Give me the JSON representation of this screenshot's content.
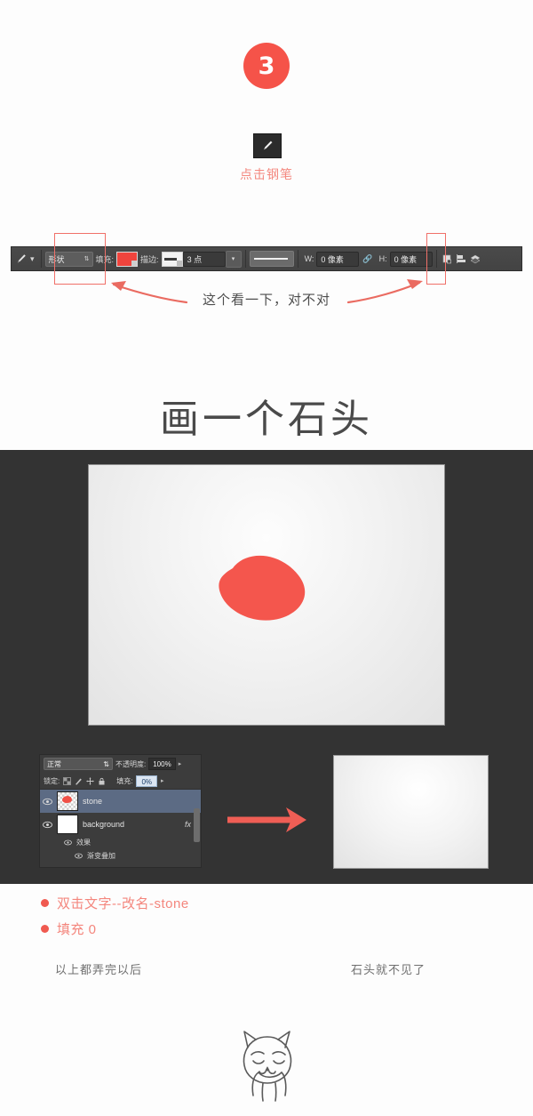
{
  "tutorial": {
    "step_number": "3",
    "pen_caption": "点击钢笔",
    "toolbar_note": "这个看一下，对不对",
    "section_title": "画一个石头"
  },
  "icons": {
    "pen_tool": "pen-tool-icon",
    "link_chain": "link-chain-icon",
    "path_operations": "path-operations-icon",
    "path_alignment": "path-alignment-icon",
    "path_arrangement": "path-arrangement-icon",
    "eye": "eye-icon",
    "lock_transparency": "lock-transparent-pixels-icon",
    "lock_image": "lock-image-pixels-icon",
    "lock_position": "lock-position-icon",
    "lock_all": "lock-all-icon"
  },
  "options_bar": {
    "tool_mode": {
      "value": "形状"
    },
    "fill": {
      "label": "填充:",
      "color": "#f0443d"
    },
    "stroke": {
      "label": "描边:",
      "color": "#f2f2f2",
      "width_value": "3 点"
    },
    "width": {
      "label": "W:",
      "value": "0 像素"
    },
    "height": {
      "label": "H:",
      "value": "0 像素"
    }
  },
  "layers_panel": {
    "blend_mode": "正常",
    "opacity_label": "不透明度:",
    "opacity_value": "100%",
    "lock_label": "锁定:",
    "fill_label": "填充:",
    "fill_value": "0%",
    "layers": [
      {
        "name": "stone",
        "selected": true,
        "has_fx": false
      },
      {
        "name": "background",
        "selected": false,
        "has_fx": true,
        "fx_mark": "fx"
      }
    ],
    "effects": {
      "group_label": "效果",
      "items": [
        "渐变叠加"
      ]
    }
  },
  "notes": [
    "双击文字--改名-stone",
    "填充  0"
  ],
  "footer": {
    "left_text": "以上都弄完以后",
    "right_text": "石头就不见了"
  },
  "colors": {
    "accent_red": "#f55349",
    "note_pink": "#f4867d",
    "workspace_dark": "#333333",
    "stone_fill": "#f4564d"
  }
}
